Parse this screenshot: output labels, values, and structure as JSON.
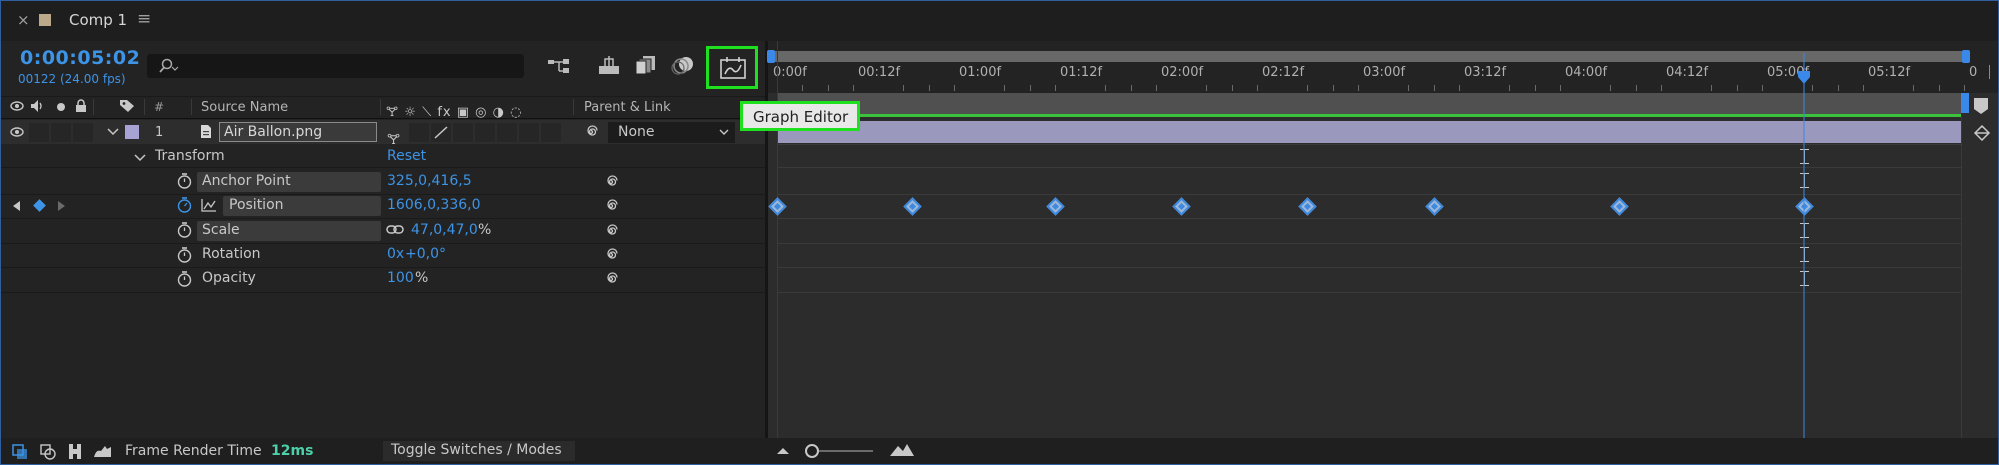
{
  "tab": {
    "close": "×",
    "title": "Comp 1",
    "menu": "≡",
    "label_color": "#bca98a"
  },
  "timecode": {
    "main": "0:00:05:02",
    "sub": "00122 (24.00 fps)"
  },
  "search": {
    "icon": "search-icon",
    "placeholder": ""
  },
  "toolbar": {
    "icons": [
      "composition-flowchart-icon",
      "draft-3d-icon",
      "frame-blending-icon",
      "motion-blur-icon",
      "graph-editor-icon"
    ],
    "graph_editor_tooltip": "Graph Editor"
  },
  "columns": {
    "av_icons": [
      "eye-icon",
      "speaker-icon",
      "solo-icon",
      "lock-icon"
    ],
    "label": "label-tag-icon",
    "number": "#",
    "source_name": "Source Name",
    "switches": "🝖 ☼ ⟍ fx ▣ ◎ ◑ ◌",
    "parent_link": "Parent & Link"
  },
  "layer": {
    "number": "1",
    "name": "Air Ballon.png",
    "parent": "None",
    "label_color": "#a7a3d4"
  },
  "transform": {
    "label": "Transform",
    "reset": "Reset",
    "properties": [
      {
        "name": "Anchor Point",
        "value": "325,0,416,5",
        "highlighted": true
      },
      {
        "name": "Position",
        "value": "1606,0,336,0",
        "highlighted": true,
        "keyframed": true
      },
      {
        "name": "Scale",
        "value": "47,0,47,0",
        "unit": "%",
        "highlighted": true,
        "constrain": true
      },
      {
        "name": "Rotation",
        "value_a": "0x",
        "value_b": "+0,0°",
        "highlighted": false
      },
      {
        "name": "Opacity",
        "value": "100",
        "unit": "%",
        "highlighted": false
      }
    ]
  },
  "timeline": {
    "ruler_labels": [
      "0:00f",
      "00:12f",
      "01:00f",
      "01:12f",
      "02:00f",
      "02:12f",
      "03:00f",
      "03:12f",
      "04:00f",
      "04:12f",
      "05:00f",
      "05:12f",
      "0"
    ],
    "current_time_seconds": 5.083,
    "position_keyframes_seconds": [
      0,
      0.667,
      1.375,
      2.0,
      2.625,
      3.25,
      4.167,
      5.083
    ],
    "playhead_color": "#3a88e8",
    "work_area_color": "#3bc13b",
    "layer_bar_color": "#9a98bd"
  },
  "status": {
    "frame_render_label": "Frame Render Time",
    "frame_render_value": "12ms",
    "toggle": "Toggle Switches / Modes",
    "icons": [
      "layer-switches-icon",
      "transfer-controls-icon",
      "in-out-icon",
      "render-time-icon"
    ]
  },
  "highlight_color": "#1ee01e"
}
